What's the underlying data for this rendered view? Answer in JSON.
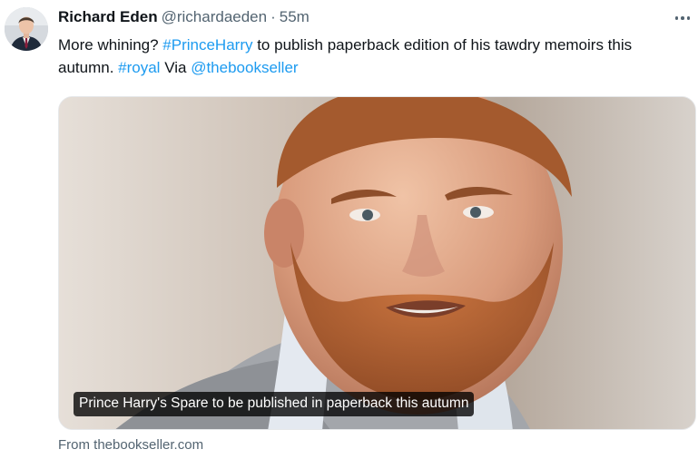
{
  "author": {
    "name": "Richard Eden",
    "handle": "@richardaeden",
    "separator": "·",
    "time": "55m"
  },
  "tweet": {
    "text_1": "More whining? ",
    "hashtag_1": "#PrinceHarry",
    "text_2": " to publish paperback edition of his tawdry memoirs this autumn. ",
    "hashtag_2": "#royal",
    "text_3": " Via ",
    "mention": "@thebookseller"
  },
  "card": {
    "caption": "Prince Harry's Spare to be published in paperback this autumn",
    "source": "From thebookseller.com"
  },
  "icons": {
    "more": "more-horizontal-icon"
  },
  "colors": {
    "link": "#1d9bf0",
    "secondary_text": "#536471",
    "primary_text": "#0f1419"
  }
}
